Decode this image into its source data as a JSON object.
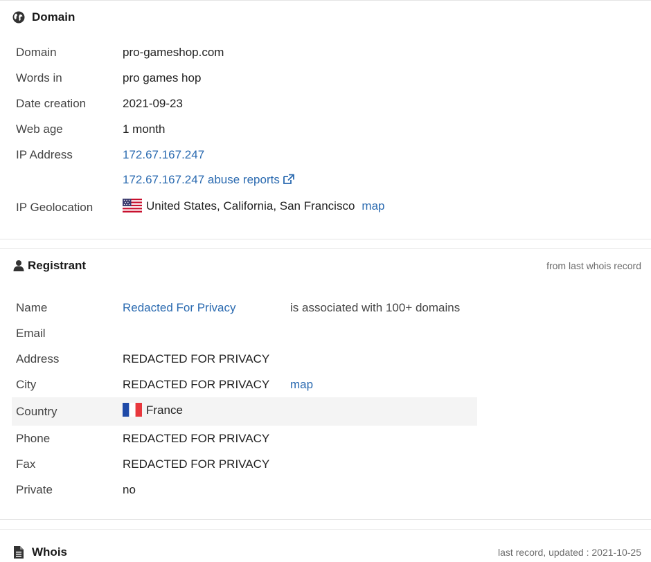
{
  "domain_section": {
    "title": "Domain",
    "rows": {
      "domain": {
        "label": "Domain",
        "value": "pro-gameshop.com"
      },
      "words": {
        "label": "Words in",
        "value": "pro games hop"
      },
      "created": {
        "label": "Date creation",
        "value": "2021-09-23"
      },
      "age": {
        "label": "Web age",
        "value": "1 month"
      },
      "ip": {
        "label": "IP Address",
        "value": "172.67.167.247"
      },
      "abuse": {
        "value": "172.67.167.247 abuse reports"
      },
      "geo": {
        "label": "IP Geolocation",
        "value": "United States, California, San Francisco",
        "map": "map"
      }
    }
  },
  "registrant_section": {
    "title": "Registrant",
    "note": "from last whois record",
    "rows": {
      "name": {
        "label": "Name",
        "value": "Redacted For Privacy",
        "extra": "is associated with 100+ domains"
      },
      "email": {
        "label": "Email",
        "value": ""
      },
      "address": {
        "label": "Address",
        "value": "REDACTED FOR PRIVACY"
      },
      "city": {
        "label": "City",
        "value": "REDACTED FOR PRIVACY",
        "map": "map"
      },
      "country": {
        "label": "Country",
        "value": "France"
      },
      "phone": {
        "label": "Phone",
        "value": "REDACTED FOR PRIVACY"
      },
      "fax": {
        "label": "Fax",
        "value": "REDACTED FOR PRIVACY"
      },
      "private": {
        "label": "Private",
        "value": "no"
      }
    }
  },
  "whois_section": {
    "title": "Whois",
    "note": "last record, updated : 2021-10-25"
  },
  "colors": {
    "link": "#2a6ab0",
    "row_highlight": "#f4f4f4",
    "divider": "#e4e4e4"
  },
  "icons": {
    "domain": "globe-icon",
    "registrant": "user-icon",
    "whois": "document-icon",
    "abuse": "external-link-icon",
    "geo_flag": "us-flag-icon",
    "country_flag": "france-flag-icon"
  }
}
